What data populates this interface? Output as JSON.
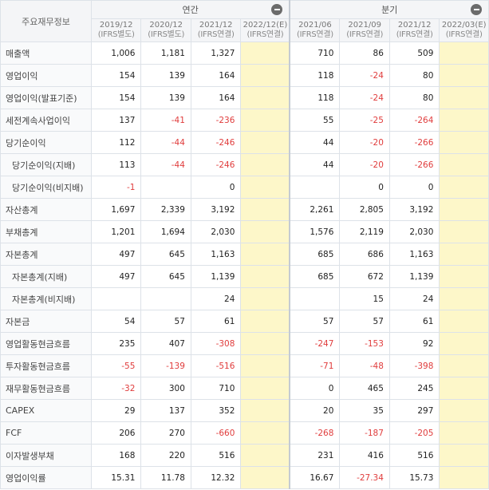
{
  "header": {
    "label": "주요재무정보",
    "annual_label": "연간",
    "quarterly_label": "분기",
    "annual_periods": [
      {
        "period": "2019/12",
        "basis": "(IFRS별도)"
      },
      {
        "period": "2020/12",
        "basis": "(IFRS별도)"
      },
      {
        "period": "2021/12",
        "basis": "(IFRS연결)"
      },
      {
        "period": "2022/12(E)",
        "basis": "(IFRS연결)"
      }
    ],
    "quarterly_periods": [
      {
        "period": "2021/06",
        "basis": "(IFRS연결)"
      },
      {
        "period": "2021/09",
        "basis": "(IFRS연결)"
      },
      {
        "period": "2021/12",
        "basis": "(IFRS연결)"
      },
      {
        "period": "2022/03(E)",
        "basis": "(IFRS연결)"
      }
    ]
  },
  "rows": [
    {
      "label": "매출액",
      "indent": false,
      "annual": [
        "1,006",
        "1,181",
        "1,327",
        ""
      ],
      "quarterly": [
        "710",
        "86",
        "509",
        ""
      ]
    },
    {
      "label": "영업이익",
      "indent": false,
      "annual": [
        "154",
        "139",
        "164",
        ""
      ],
      "quarterly": [
        "118",
        "-24",
        "80",
        ""
      ]
    },
    {
      "label": "영업이익(발표기준)",
      "indent": false,
      "annual": [
        "154",
        "139",
        "164",
        ""
      ],
      "quarterly": [
        "118",
        "-24",
        "80",
        ""
      ]
    },
    {
      "label": "세전계속사업이익",
      "indent": false,
      "annual": [
        "137",
        "-41",
        "-236",
        ""
      ],
      "quarterly": [
        "55",
        "-25",
        "-264",
        ""
      ]
    },
    {
      "label": "당기순이익",
      "indent": false,
      "annual": [
        "112",
        "-44",
        "-246",
        ""
      ],
      "quarterly": [
        "44",
        "-20",
        "-266",
        ""
      ]
    },
    {
      "label": "당기순이익(지배)",
      "indent": true,
      "annual": [
        "113",
        "-44",
        "-246",
        ""
      ],
      "quarterly": [
        "44",
        "-20",
        "-266",
        ""
      ]
    },
    {
      "label": "당기순이익(비지배)",
      "indent": true,
      "annual": [
        "-1",
        "",
        "0",
        ""
      ],
      "quarterly": [
        "",
        "0",
        "0",
        ""
      ]
    },
    {
      "label": "자산총계",
      "indent": false,
      "annual": [
        "1,697",
        "2,339",
        "3,192",
        ""
      ],
      "quarterly": [
        "2,261",
        "2,805",
        "3,192",
        ""
      ]
    },
    {
      "label": "부채총계",
      "indent": false,
      "annual": [
        "1,201",
        "1,694",
        "2,030",
        ""
      ],
      "quarterly": [
        "1,576",
        "2,119",
        "2,030",
        ""
      ]
    },
    {
      "label": "자본총계",
      "indent": false,
      "annual": [
        "497",
        "645",
        "1,163",
        ""
      ],
      "quarterly": [
        "685",
        "686",
        "1,163",
        ""
      ]
    },
    {
      "label": "자본총계(지배)",
      "indent": true,
      "annual": [
        "497",
        "645",
        "1,139",
        ""
      ],
      "quarterly": [
        "685",
        "672",
        "1,139",
        ""
      ]
    },
    {
      "label": "자본총계(비지배)",
      "indent": true,
      "annual": [
        "",
        "",
        "24",
        ""
      ],
      "quarterly": [
        "",
        "15",
        "24",
        ""
      ]
    },
    {
      "label": "자본금",
      "indent": false,
      "annual": [
        "54",
        "57",
        "61",
        ""
      ],
      "quarterly": [
        "57",
        "57",
        "61",
        ""
      ]
    },
    {
      "label": "영업활동현금흐름",
      "indent": false,
      "annual": [
        "235",
        "407",
        "-308",
        ""
      ],
      "quarterly": [
        "-247",
        "-153",
        "92",
        ""
      ]
    },
    {
      "label": "투자활동현금흐름",
      "indent": false,
      "annual": [
        "-55",
        "-139",
        "-516",
        ""
      ],
      "quarterly": [
        "-71",
        "-48",
        "-398",
        ""
      ]
    },
    {
      "label": "재무활동현금흐름",
      "indent": false,
      "annual": [
        "-32",
        "300",
        "710",
        ""
      ],
      "quarterly": [
        "0",
        "465",
        "245",
        ""
      ]
    },
    {
      "label": "CAPEX",
      "indent": false,
      "annual": [
        "29",
        "137",
        "352",
        ""
      ],
      "quarterly": [
        "20",
        "35",
        "297",
        ""
      ]
    },
    {
      "label": "FCF",
      "indent": false,
      "annual": [
        "206",
        "270",
        "-660",
        ""
      ],
      "quarterly": [
        "-268",
        "-187",
        "-205",
        ""
      ]
    },
    {
      "label": "이자발생부채",
      "indent": false,
      "annual": [
        "168",
        "220",
        "516",
        ""
      ],
      "quarterly": [
        "231",
        "416",
        "516",
        ""
      ]
    },
    {
      "label": "영업이익률",
      "indent": false,
      "annual": [
        "15.31",
        "11.78",
        "12.32",
        ""
      ],
      "quarterly": [
        "16.67",
        "-27.34",
        "15.73",
        ""
      ]
    }
  ],
  "colors": {
    "negative": "#e03c3c",
    "forecast_bg": "#fdf7c9",
    "header_bg": "#f4f5f7"
  }
}
